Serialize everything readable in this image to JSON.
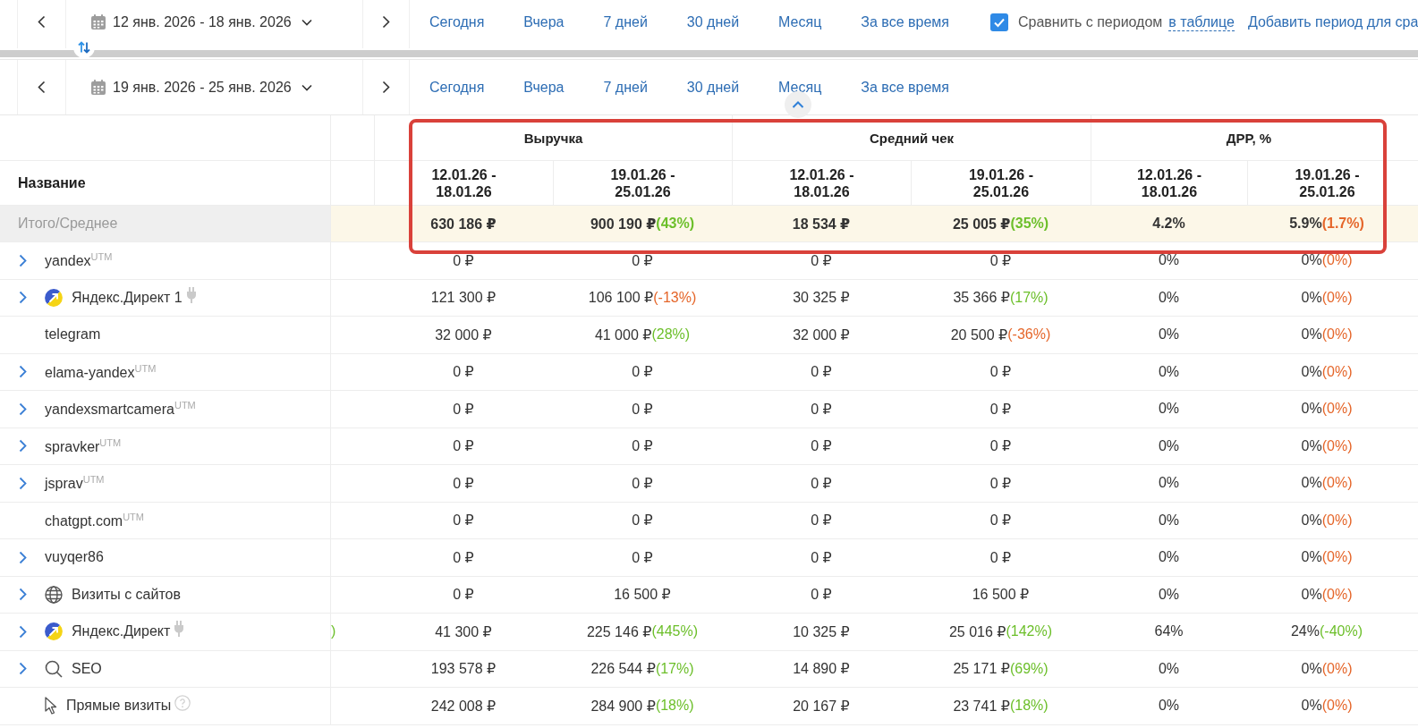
{
  "period_bars": [
    {
      "date_range": "12 янв. 2026 - 18 янв. 2026",
      "presets": [
        "Сегодня",
        "Вчера",
        "7 дней",
        "30 дней",
        "Месяц",
        "За все время"
      ],
      "compare": {
        "checked": true,
        "label": "Сравнить с периодом",
        "link": "в таблице"
      },
      "add_link": "Добавить период для сра"
    },
    {
      "date_range": "19 янв. 2026 - 25 янв. 2026",
      "presets": [
        "Сегодня",
        "Вчера",
        "7 дней",
        "30 дней",
        "Месяц",
        "За все время"
      ]
    }
  ],
  "table": {
    "name_header": "Название",
    "groups": [
      {
        "title": "Выручка",
        "highlighted": true,
        "columns": [
          "12.01.26 - 18.01.26",
          "19.01.26 - 25.01.26"
        ]
      },
      {
        "title": "Средний чек",
        "highlighted": true,
        "columns": [
          "12.01.26 - 18.01.26",
          "19.01.26 - 25.01.26"
        ]
      },
      {
        "title": "ДРР, %",
        "highlighted": true,
        "columns": [
          "12.01.26 - 18.01.26",
          "19.01.26 - 25.01.26"
        ]
      }
    ],
    "total": {
      "name": "Итого/Среднее",
      "cells": [
        {
          "value": "630 186 ₽"
        },
        {
          "value": "900 190 ₽",
          "change": "(43%)",
          "favorable": true
        },
        {
          "value": "18 534 ₽"
        },
        {
          "value": "25 005 ₽",
          "change": "(35%)",
          "favorable": true
        },
        {
          "value": "4.2%"
        },
        {
          "value": "5.9%",
          "change": "(1.7%)",
          "favorable": false
        }
      ]
    },
    "rows": [
      {
        "name": "yandex$^{UTM}$",
        "expandable": true,
        "kind": "source",
        "cells": [
          {
            "value": "0 ₽"
          },
          {
            "value": "0 ₽"
          },
          {
            "value": "0 ₽"
          },
          {
            "value": "0 ₽"
          },
          {
            "value": "0%"
          },
          {
            "value": "0%",
            "change": "(0%)",
            "favorable": false
          }
        ]
      },
      {
        "name": "Яндекс.Директ 1",
        "expandable": true,
        "kind": "ad_account",
        "cells": [
          {
            "value": "121 300 ₽"
          },
          {
            "value": "106 100 ₽",
            "change": "(-13%)",
            "favorable": false
          },
          {
            "value": "30 325 ₽"
          },
          {
            "value": "35 366 ₽",
            "change": "(17%)",
            "favorable": true
          },
          {
            "value": "0%"
          },
          {
            "value": "0%",
            "change": "(0%)",
            "favorable": false
          }
        ]
      },
      {
        "name": "telegram",
        "expandable": false,
        "kind": "source",
        "cells": [
          {
            "value": "32 000 ₽"
          },
          {
            "value": "41 000 ₽",
            "change": "(28%)",
            "favorable": true
          },
          {
            "value": "32 000 ₽"
          },
          {
            "value": "20 500 ₽",
            "change": "(-36%)",
            "favorable": false
          },
          {
            "value": "0%"
          },
          {
            "value": "0%",
            "change": "(0%)",
            "favorable": false
          }
        ]
      },
      {
        "name": "elama-yandex$^{UTM}$",
        "expandable": true,
        "kind": "source",
        "cells": [
          {
            "value": "0 ₽"
          },
          {
            "value": "0 ₽"
          },
          {
            "value": "0 ₽"
          },
          {
            "value": "0 ₽"
          },
          {
            "value": "0%"
          },
          {
            "value": "0%",
            "change": "(0%)",
            "favorable": false
          }
        ]
      },
      {
        "name": "yandexsmartcamera$^{UTM}$",
        "expandable": true,
        "kind": "source",
        "cells": [
          {
            "value": "0 ₽"
          },
          {
            "value": "0 ₽"
          },
          {
            "value": "0 ₽"
          },
          {
            "value": "0 ₽"
          },
          {
            "value": "0%"
          },
          {
            "value": "0%",
            "change": "(0%)",
            "favorable": false
          }
        ]
      },
      {
        "name": "spravker$^{UTM}$",
        "expandable": true,
        "kind": "source",
        "cells": [
          {
            "value": "0 ₽"
          },
          {
            "value": "0 ₽"
          },
          {
            "value": "0 ₽"
          },
          {
            "value": "0 ₽"
          },
          {
            "value": "0%"
          },
          {
            "value": "0%",
            "change": "(0%)",
            "favorable": false
          }
        ]
      },
      {
        "name": "jsprav$^{UTM}$",
        "expandable": true,
        "kind": "source",
        "cells": [
          {
            "value": "0 ₽"
          },
          {
            "value": "0 ₽"
          },
          {
            "value": "0 ₽"
          },
          {
            "value": "0 ₽"
          },
          {
            "value": "0%"
          },
          {
            "value": "0%",
            "change": "(0%)",
            "favorable": false
          }
        ]
      },
      {
        "name": "chatgpt.com$^{UTM}$",
        "expandable": false,
        "kind": "source",
        "cells": [
          {
            "value": "0 ₽"
          },
          {
            "value": "0 ₽"
          },
          {
            "value": "0 ₽"
          },
          {
            "value": "0 ₽"
          },
          {
            "value": "0%"
          },
          {
            "value": "0%",
            "change": "(0%)",
            "favorable": false
          }
        ]
      },
      {
        "name": "vuyqer86",
        "expandable": true,
        "kind": "source",
        "cells": [
          {
            "value": "0 ₽"
          },
          {
            "value": "0 ₽"
          },
          {
            "value": "0 ₽"
          },
          {
            "value": "0 ₽"
          },
          {
            "value": "0%"
          },
          {
            "value": "0%",
            "change": "(0%)",
            "favorable": false
          }
        ]
      },
      {
        "name": "Визиты с сайтов",
        "expandable": true,
        "kind": "sites",
        "cells": [
          {
            "value": "0 ₽"
          },
          {
            "value": "16 500 ₽"
          },
          {
            "value": "0 ₽"
          },
          {
            "value": "16 500 ₽"
          },
          {
            "value": "0%"
          },
          {
            "value": "0%",
            "change": "(0%)",
            "favorable": false
          }
        ]
      },
      {
        "name": "Яндекс.Директ",
        "expandable": true,
        "kind": "ad_account",
        "column_2": {
          "text": ")",
          "favorable": true
        },
        "cells": [
          {
            "value": "41 300 ₽"
          },
          {
            "value": "225 146 ₽",
            "change": "(445%)",
            "favorable": true
          },
          {
            "value": "10 325 ₽"
          },
          {
            "value": "25 016 ₽",
            "change": "(142%)",
            "favorable": true
          },
          {
            "value": "64%"
          },
          {
            "value": "24%",
            "change": "(-40%)",
            "favorable": true
          }
        ]
      },
      {
        "name": "SEO",
        "expandable": true,
        "kind": "seo",
        "cells": [
          {
            "value": "193 578 ₽"
          },
          {
            "value": "226 544 ₽",
            "change": "(17%)",
            "favorable": true
          },
          {
            "value": "14 890 ₽"
          },
          {
            "value": "25 171 ₽",
            "change": "(69%)",
            "favorable": true
          },
          {
            "value": "0%"
          },
          {
            "value": "0%",
            "change": "(0%)",
            "favorable": false
          }
        ]
      },
      {
        "name": "Прямые визиты",
        "expandable": false,
        "kind": "direct",
        "cells": [
          {
            "value": "242 008 ₽"
          },
          {
            "value": "284 900 ₽",
            "change": "(18%)",
            "favorable": true
          },
          {
            "value": "20 167 ₽"
          },
          {
            "value": "23 741 ₽",
            "change": "(18%)",
            "favorable": true
          },
          {
            "value": "0%"
          },
          {
            "value": "0%",
            "change": "(0%)",
            "favorable": false
          }
        ]
      }
    ]
  }
}
